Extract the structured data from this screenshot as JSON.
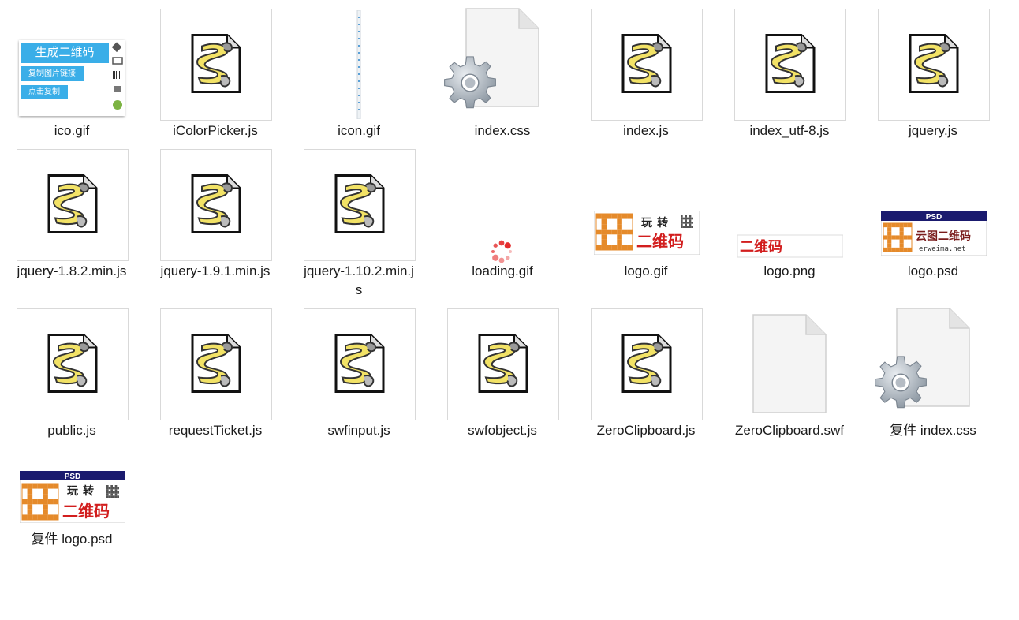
{
  "files": [
    {
      "name": "ico.gif",
      "kind": "ico-preview",
      "preview": {
        "btn1": "生成二维码",
        "btn2": "复制图片链接",
        "btn3": "点击复制"
      }
    },
    {
      "name": "iColorPicker.js",
      "kind": "script"
    },
    {
      "name": "icon.gif",
      "kind": "strip"
    },
    {
      "name": "index.css",
      "kind": "settings"
    },
    {
      "name": "index.js",
      "kind": "script"
    },
    {
      "name": "index_utf-8.js",
      "kind": "script"
    },
    {
      "name": "jquery.js",
      "kind": "script"
    },
    {
      "name": "jquery-1.8.2.min.js",
      "kind": "script"
    },
    {
      "name": "jquery-1.9.1.min.js",
      "kind": "script"
    },
    {
      "name": "jquery-1.10.2.min.js",
      "kind": "script"
    },
    {
      "name": "loading.gif",
      "kind": "loading"
    },
    {
      "name": "logo.gif",
      "kind": "logo-gif",
      "preview": {
        "text1": "玩",
        "text2": "转",
        "text3": "二维码"
      }
    },
    {
      "name": "logo.png",
      "kind": "logo-png",
      "preview": {
        "text": "二维码"
      }
    },
    {
      "name": "logo.psd",
      "kind": "logo-psd",
      "preview": {
        "badge": "PSD",
        "text": "云图二维码",
        "url": "erweima.net"
      }
    },
    {
      "name": "public.js",
      "kind": "script"
    },
    {
      "name": "requestTicket.js",
      "kind": "script"
    },
    {
      "name": "swfinput.js",
      "kind": "script"
    },
    {
      "name": "swfobject.js",
      "kind": "script"
    },
    {
      "name": "ZeroClipboard.js",
      "kind": "script"
    },
    {
      "name": "ZeroClipboard.swf",
      "kind": "blank"
    },
    {
      "name": "复件 index.css",
      "kind": "settings"
    },
    {
      "name": "复件 logo.psd",
      "kind": "logo-psd2",
      "preview": {
        "badge": "PSD",
        "text1": "玩",
        "text2": "转",
        "text3": "二维码"
      }
    }
  ],
  "colors": {
    "script_yellow": "#f2e266",
    "qr_orange": "#e58a2a",
    "brand_red": "#d21e1e",
    "button_blue": "#3aaee8",
    "psd_navy": "#1a1a6e"
  }
}
